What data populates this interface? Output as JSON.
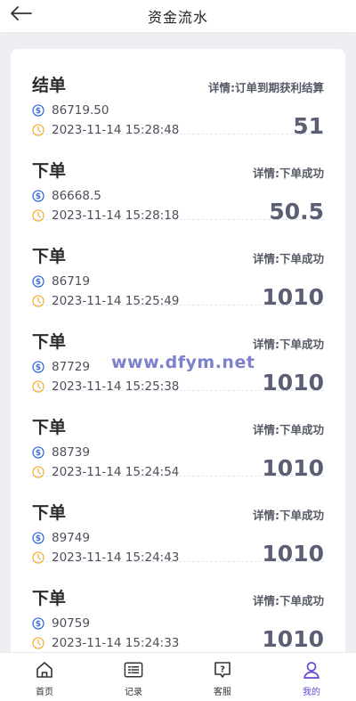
{
  "header": {
    "title": "资金流水",
    "back_icon": "arrow-left-icon"
  },
  "watermark": "www.dfym.net",
  "records": [
    {
      "type": "结单",
      "detail": "详情:订单到期获利结算",
      "order_no": "86719.50",
      "time": "2023-11-14 15:28:48",
      "amount": "51"
    },
    {
      "type": "下单",
      "detail": "详情:下单成功",
      "order_no": "86668.5",
      "time": "2023-11-14 15:28:18",
      "amount": "50.5"
    },
    {
      "type": "下单",
      "detail": "详情:下单成功",
      "order_no": "86719",
      "time": "2023-11-14 15:25:49",
      "amount": "1010"
    },
    {
      "type": "下单",
      "detail": "详情:下单成功",
      "order_no": "87729",
      "time": "2023-11-14 15:25:38",
      "amount": "1010"
    },
    {
      "type": "下单",
      "detail": "详情:下单成功",
      "order_no": "88739",
      "time": "2023-11-14 15:24:54",
      "amount": "1010"
    },
    {
      "type": "下单",
      "detail": "详情:下单成功",
      "order_no": "89749",
      "time": "2023-11-14 15:24:43",
      "amount": "1010"
    },
    {
      "type": "下单",
      "detail": "详情:下单成功",
      "order_no": "90759",
      "time": "2023-11-14 15:24:33",
      "amount": "1010"
    }
  ],
  "tabbar": {
    "items": [
      {
        "label": "首页",
        "icon": "home-icon"
      },
      {
        "label": "记录",
        "icon": "list-icon"
      },
      {
        "label": "客服",
        "icon": "help-chat-icon"
      },
      {
        "label": "我的",
        "icon": "user-icon"
      }
    ],
    "active_index": 3
  },
  "colors": {
    "accent": "#6a46d6",
    "dollar_icon": "#3b6fe0",
    "clock_icon": "#f0b43a",
    "amount": "#5b5f73"
  }
}
